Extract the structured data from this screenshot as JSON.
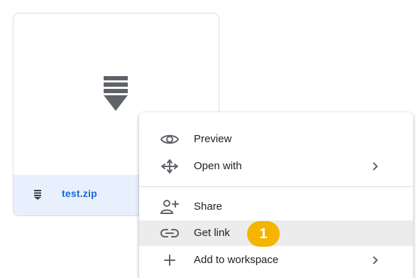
{
  "file": {
    "name": "test.zip",
    "icon": "zip-file-icon"
  },
  "context_menu": {
    "items": [
      {
        "label": "Preview",
        "icon": "eye-icon",
        "has_submenu": false
      },
      {
        "label": "Open with",
        "icon": "move-arrows-icon",
        "has_submenu": true
      },
      {
        "label": "Share",
        "icon": "add-person-icon",
        "has_submenu": false
      },
      {
        "label": "Get link",
        "icon": "link-icon",
        "has_submenu": false,
        "highlighted": true
      },
      {
        "label": "Add to workspace",
        "icon": "plus-icon",
        "has_submenu": true
      }
    ]
  },
  "step_badge": {
    "label": "1",
    "color": "#f4b400"
  },
  "colors": {
    "file_footer_bg": "#e8f0fe",
    "file_name": "#1967d2",
    "menu_highlight": "#ececec"
  }
}
